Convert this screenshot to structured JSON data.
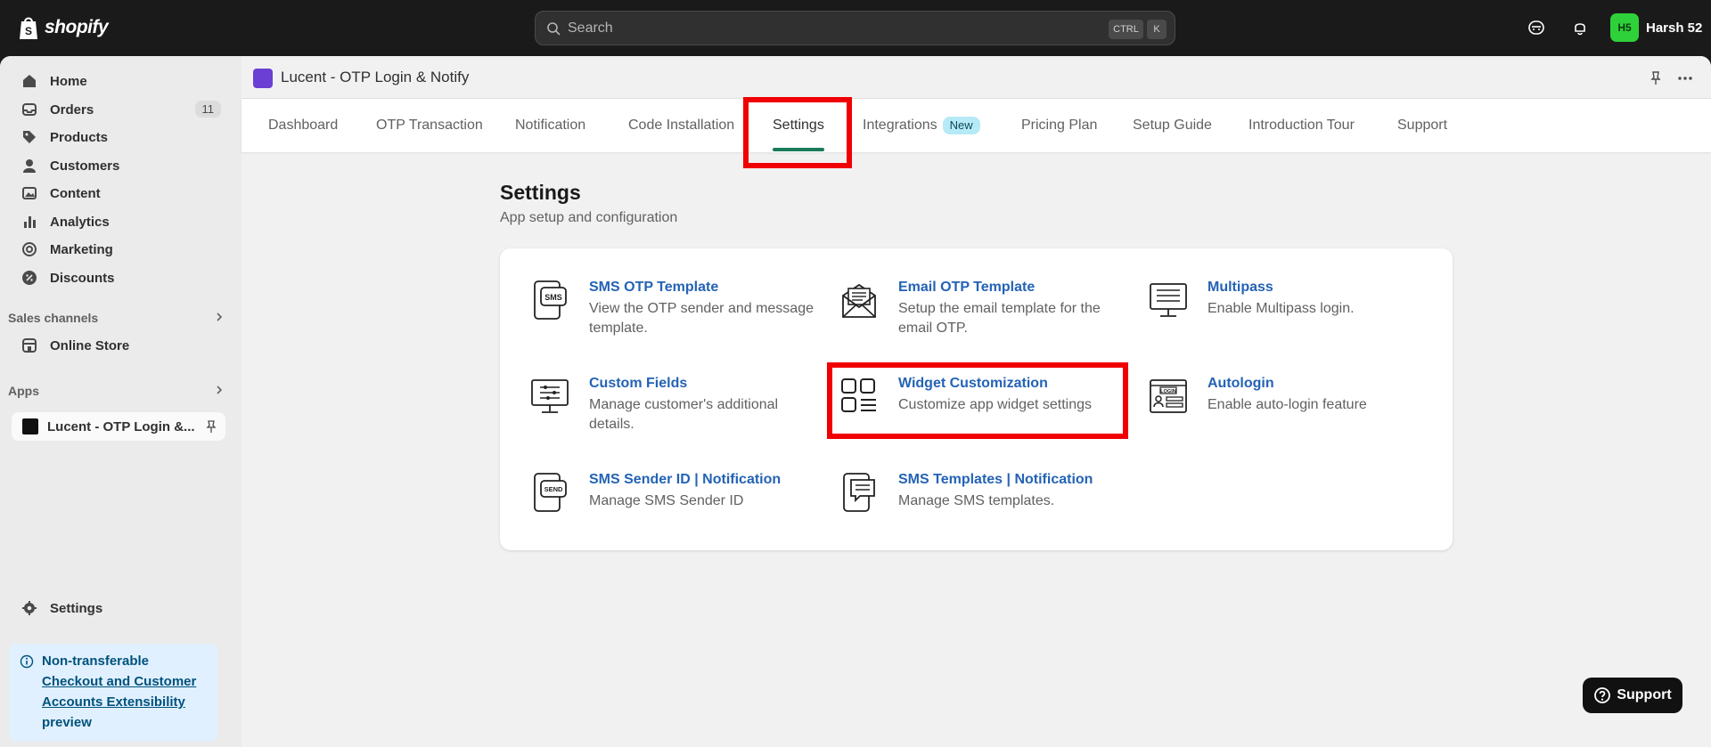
{
  "topbar": {
    "brand": "shopify",
    "search_placeholder": "Search",
    "shortcut_ctrl": "CTRL",
    "shortcut_k": "K",
    "user_initials": "H5",
    "user_name": "Harsh 52"
  },
  "sidebar": {
    "items": [
      {
        "label": "Home",
        "icon": "home-icon"
      },
      {
        "label": "Orders",
        "icon": "orders-icon",
        "badge": "11"
      },
      {
        "label": "Products",
        "icon": "tag-icon"
      },
      {
        "label": "Customers",
        "icon": "person-icon"
      },
      {
        "label": "Content",
        "icon": "content-icon"
      },
      {
        "label": "Analytics",
        "icon": "chart-icon"
      },
      {
        "label": "Marketing",
        "icon": "target-icon"
      },
      {
        "label": "Discounts",
        "icon": "discount-icon"
      }
    ],
    "sales_channels_label": "Sales channels",
    "online_store": "Online Store",
    "apps_label": "Apps",
    "app_item": "Lucent - OTP Login &...",
    "settings": "Settings",
    "notice": {
      "title": "Non-transferable",
      "link": "Checkout and Customer Accounts Extensibility",
      "suffix": "preview"
    }
  },
  "app": {
    "title": "Lucent - OTP Login & Notify",
    "tabs": [
      {
        "label": "Dashboard"
      },
      {
        "label": "OTP Transaction"
      },
      {
        "label": "Notification"
      },
      {
        "label": "Code Installation"
      },
      {
        "label": "Settings",
        "active": true
      },
      {
        "label": "Integrations",
        "badge": "New"
      },
      {
        "label": "Pricing Plan"
      },
      {
        "label": "Setup Guide"
      },
      {
        "label": "Introduction Tour"
      },
      {
        "label": "Support"
      }
    ]
  },
  "settings_page": {
    "title": "Settings",
    "subtitle": "App setup and configuration",
    "items": [
      {
        "title": "SMS OTP Template",
        "description": "View the OTP sender and message template.",
        "icon": "sms-phone-icon"
      },
      {
        "title": "Email OTP Template",
        "description": "Setup the email template for the email OTP.",
        "icon": "envelope-icon"
      },
      {
        "title": "Multipass",
        "description": "Enable Multipass login.",
        "icon": "monitor-list-icon"
      },
      {
        "title": "Custom Fields",
        "description": "Manage customer's additional details.",
        "icon": "monitor-sliders-icon"
      },
      {
        "title": "Widget Customization",
        "description": "Customize app widget settings",
        "icon": "widgets-grid-icon"
      },
      {
        "title": "Autologin",
        "description": "Enable auto-login feature",
        "icon": "login-window-icon"
      },
      {
        "title": "SMS Sender ID | Notification",
        "description": "Manage SMS Sender ID",
        "icon": "send-phone-icon"
      },
      {
        "title": "SMS Templates | Notification",
        "description": "Manage SMS templates.",
        "icon": "phone-message-icon"
      }
    ]
  },
  "support_button": "Support",
  "colors": {
    "highlight": "#f00000",
    "link": "#2463b5",
    "active_tab_underline": "#1a7a5a",
    "avatar": "#2fd13a"
  }
}
